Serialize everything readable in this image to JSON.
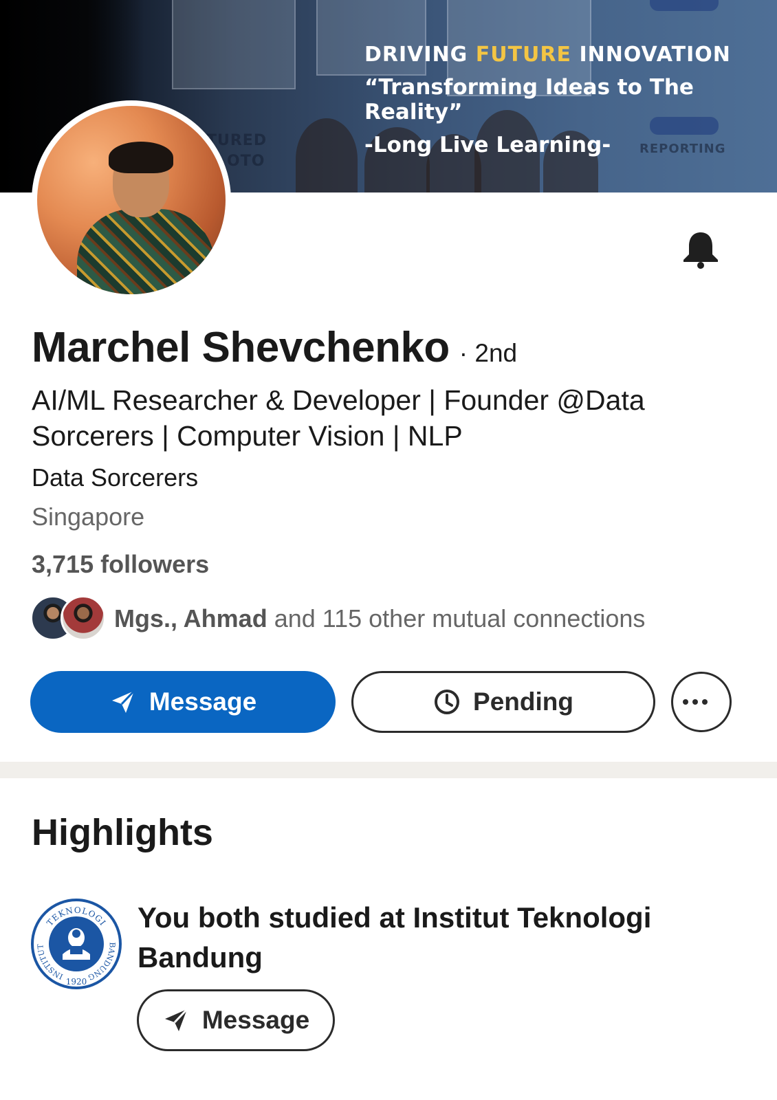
{
  "banner": {
    "line1_prefix": "DRIVING ",
    "line1_highlight": "FUTURE",
    "line1_suffix": " INNOVATION",
    "line2": "“Transforming Ideas to The Reality”",
    "line3": "-Long Live Learning-",
    "highlight_color": "#f3c544"
  },
  "profile": {
    "name": "Marchel Shevchenko",
    "degree": "· 2nd",
    "headline": "AI/ML Researcher & Developer | Founder @Data Sorcerers | Computer Vision | NLP",
    "company": "Data Sorcerers",
    "location": "Singapore",
    "followers": "3,715 followers"
  },
  "mutual": {
    "names_bold": "Mgs., Ahmad",
    "rest": " and 115 other mutual connections"
  },
  "actions": {
    "message_label": "Message",
    "pending_label": "Pending",
    "more_icon": "ellipsis-icon",
    "primary_color": "#0a66c2"
  },
  "highlights": {
    "title": "Highlights",
    "item_text": "You both studied at Institut Teknologi Bandung",
    "item_button": "Message",
    "logo_top_text": "TEKNOLOGI",
    "logo_left_text": "INSTITUT",
    "logo_right_text": "BANDUNG",
    "logo_year": "1920"
  }
}
